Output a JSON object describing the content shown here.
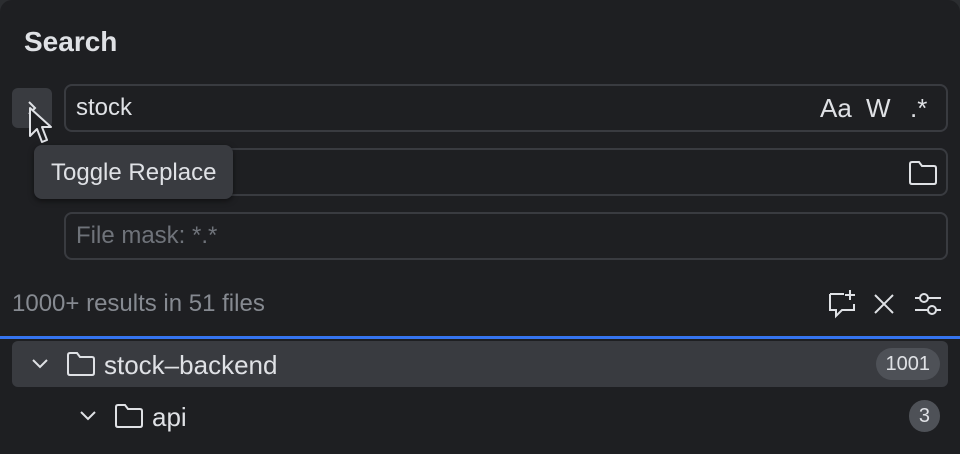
{
  "panel": {
    "title": "Search"
  },
  "search": {
    "value": "stock",
    "match_case_label": "Aa",
    "words_label": "W",
    "regex_label": ".*"
  },
  "replace": {
    "placeholder": ""
  },
  "filemask": {
    "placeholder": "File mask: *.*"
  },
  "tooltip": {
    "text": "Toggle Replace"
  },
  "status": {
    "text": "1000+ results in 51 files"
  },
  "tree": {
    "rows": [
      {
        "label": "stock–backend",
        "count": "1001"
      },
      {
        "label": "api",
        "count": "3"
      }
    ]
  },
  "colors": {
    "accent": "#3574f0",
    "background": "#1e1f22",
    "selection": "#393b40"
  }
}
